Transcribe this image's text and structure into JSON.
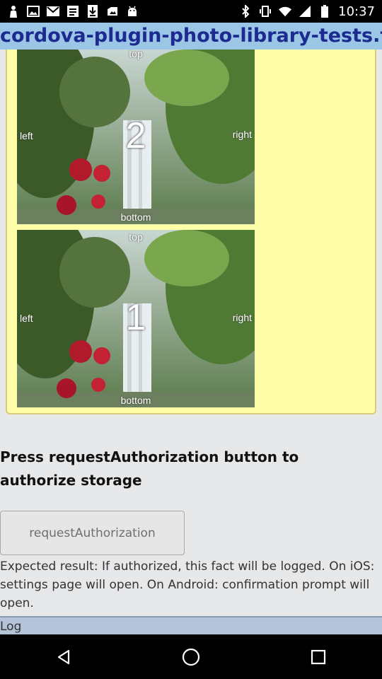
{
  "status_bar": {
    "time": "10:37",
    "left_icons": [
      "person-icon",
      "image-icon",
      "gmail-icon",
      "document-icon",
      "download-icon",
      "photos-icon",
      "android-icon"
    ],
    "right_icons": [
      "bluetooth-icon",
      "vibrate-icon",
      "wifi-icon",
      "signal-icon",
      "battery-icon"
    ]
  },
  "header": {
    "title": "cordova-plugin-photo-library-tests.tes"
  },
  "gallery": {
    "photos": [
      {
        "number": "2",
        "top": "top",
        "left": "left",
        "right": "right",
        "bottom": "bottom"
      },
      {
        "number": "1",
        "top": "top",
        "left": "left",
        "right": "right",
        "bottom": "bottom"
      }
    ]
  },
  "content": {
    "instruction": "Press requestAuthorization button to authorize storage",
    "button_label": "requestAuthorization",
    "expected": "Expected result: If authorized, this fact will be logged. On iOS: settings page will open. On Android: confirmation prompt will open.",
    "log_label": "Log"
  },
  "colors": {
    "title_bg": "#9cc6e6",
    "title_text": "#1d2a8f",
    "gallery_bg": "#ffffaa",
    "page_bg": "#e7e8ea"
  },
  "nav_bar": {
    "buttons": [
      "back-icon",
      "home-icon",
      "recents-icon"
    ]
  }
}
